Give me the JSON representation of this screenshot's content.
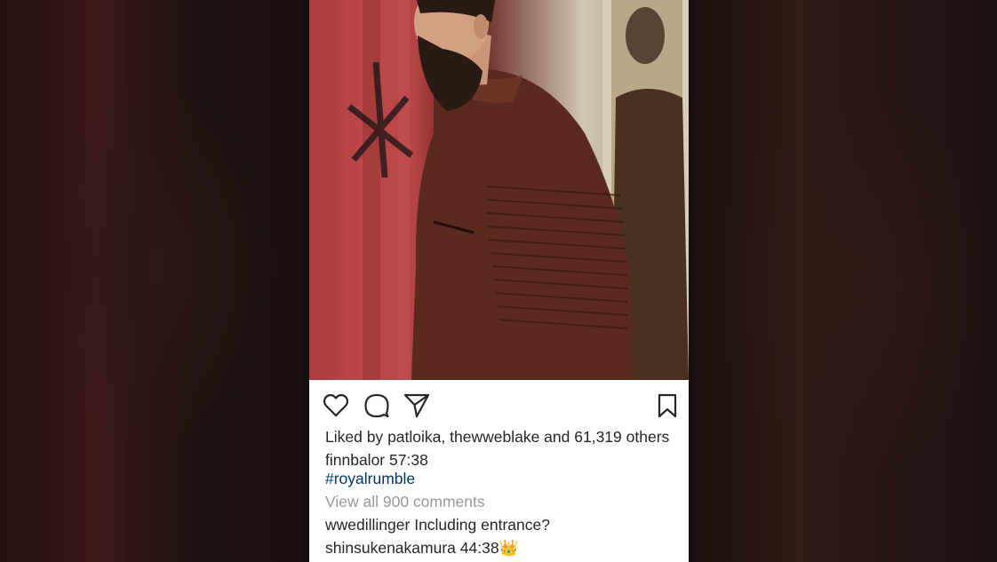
{
  "post": {
    "icons": {
      "like": "heart-icon",
      "comment": "comment-bubble-icon",
      "share": "paper-plane-icon",
      "save": "bookmark-icon"
    },
    "likes": {
      "prefix": "Liked by",
      "user1": "patloika,",
      "user2": "thewweblake",
      "and": "and",
      "others": "61,319 others"
    },
    "caption": {
      "username": "finnbalor",
      "text": "57:38",
      "hashtag": "#royalrumble"
    },
    "view_comments": "View all 900 comments",
    "comments": [
      {
        "username": "wwedillinger",
        "text": "Including entrance?"
      },
      {
        "username": "shinsukenakamura",
        "text": "44:38👑"
      }
    ]
  }
}
